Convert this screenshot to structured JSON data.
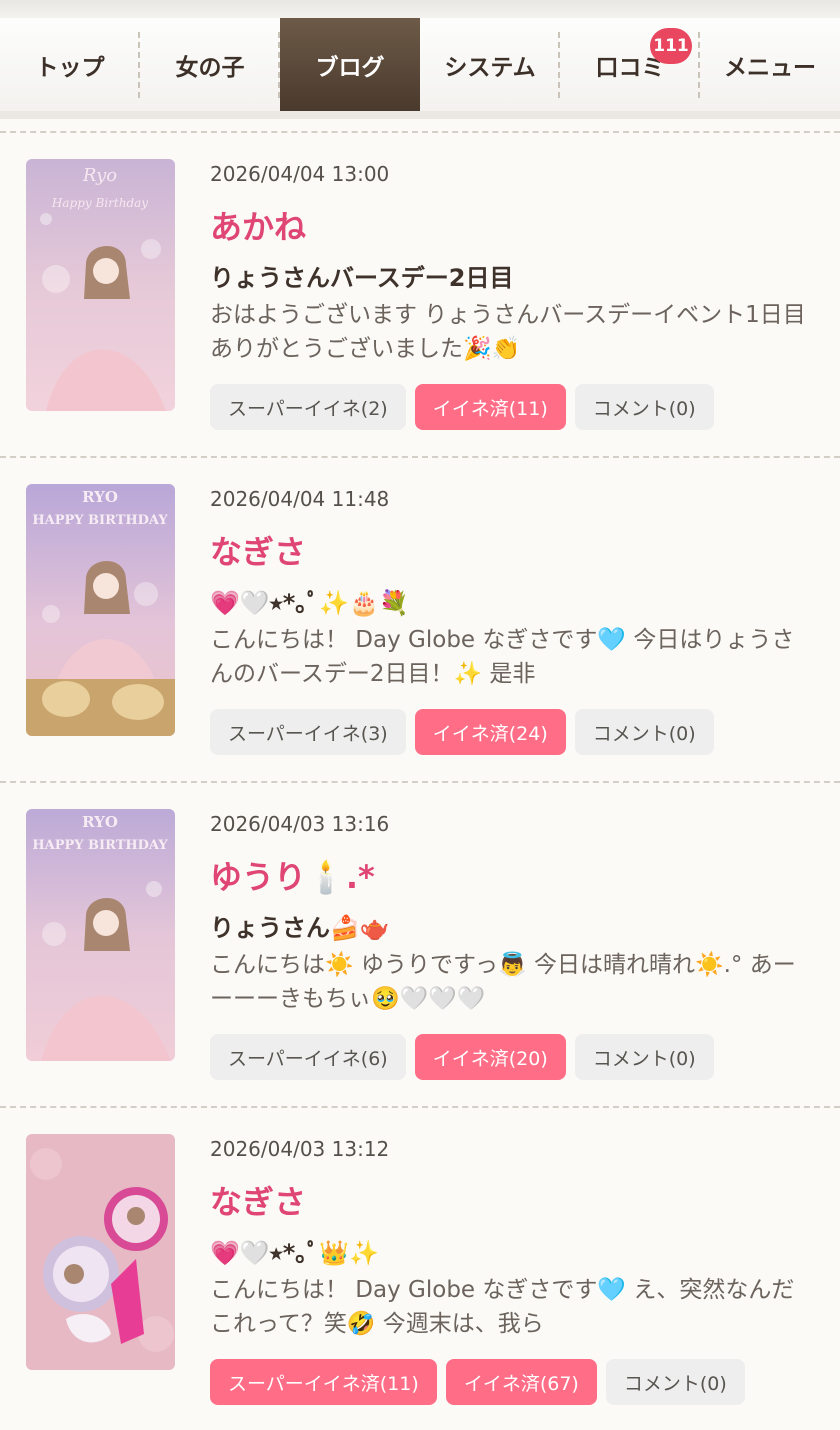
{
  "nav": {
    "items": [
      "トップ",
      "女の子",
      "ブログ",
      "システム",
      "口コミ",
      "メニュー"
    ],
    "active_index": 2,
    "review_badge": "111"
  },
  "posts": [
    {
      "date": "2026/04/04 13:00",
      "author": "あかね",
      "title": "りょうさんバースデー2日目",
      "excerpt": "おはようございます りょうさんバースデーイベント1日目 ありがとうございました🎉👏",
      "super_like": "スーパーイイネ(2)",
      "super_like_done": false,
      "like": "イイネ済(11)",
      "comment": "コメント(0)",
      "thumb_text_1": "Ryo",
      "thumb_text_2": "Happy Birthday"
    },
    {
      "date": "2026/04/04 11:48",
      "author": "なぎさ",
      "title": "💗🤍⭒*｡ﾟ✨🎂💐",
      "excerpt": "こんにちは！ Day Globe なぎさです🩵 今日はりょうさんのバースデー2日目！✨ 是非",
      "super_like": "スーパーイイネ(3)",
      "super_like_done": false,
      "like": "イイネ済(24)",
      "comment": "コメント(0)",
      "thumb_text_1": "RYO",
      "thumb_text_2": "HAPPY BIRTHDAY"
    },
    {
      "date": "2026/04/03 13:16",
      "author": "ゆうり🕯️.*",
      "title": "りょうさん🍰🫖",
      "excerpt": "こんにちは☀️ ゆうりですっ👼 今日は晴れ晴れ☀️.° あーーーーきもちぃ🥹🤍🤍🤍",
      "super_like": "スーパーイイネ(6)",
      "super_like_done": false,
      "like": "イイネ済(20)",
      "comment": "コメント(0)",
      "thumb_text_1": "RYO",
      "thumb_text_2": "HAPPY BIRTHDAY"
    },
    {
      "date": "2026/04/03 13:12",
      "author": "なぎさ",
      "title": "💗🤍⭒*｡ﾟ👑✨",
      "excerpt": "こんにちは！ Day Globe なぎさです🩵 え、突然なんだこれって？笑🤣 今週末は、我ら",
      "super_like": "スーパーイイネ済(11)",
      "super_like_done": true,
      "like": "イイネ済(67)",
      "comment": "コメント(0)",
      "thumb_text_1": "",
      "thumb_text_2": ""
    }
  ],
  "colors": {
    "accent_pink": "#e04674",
    "liked_button": "#ff6d87",
    "nav_active": "#5a4838",
    "badge": "#e8475f"
  }
}
